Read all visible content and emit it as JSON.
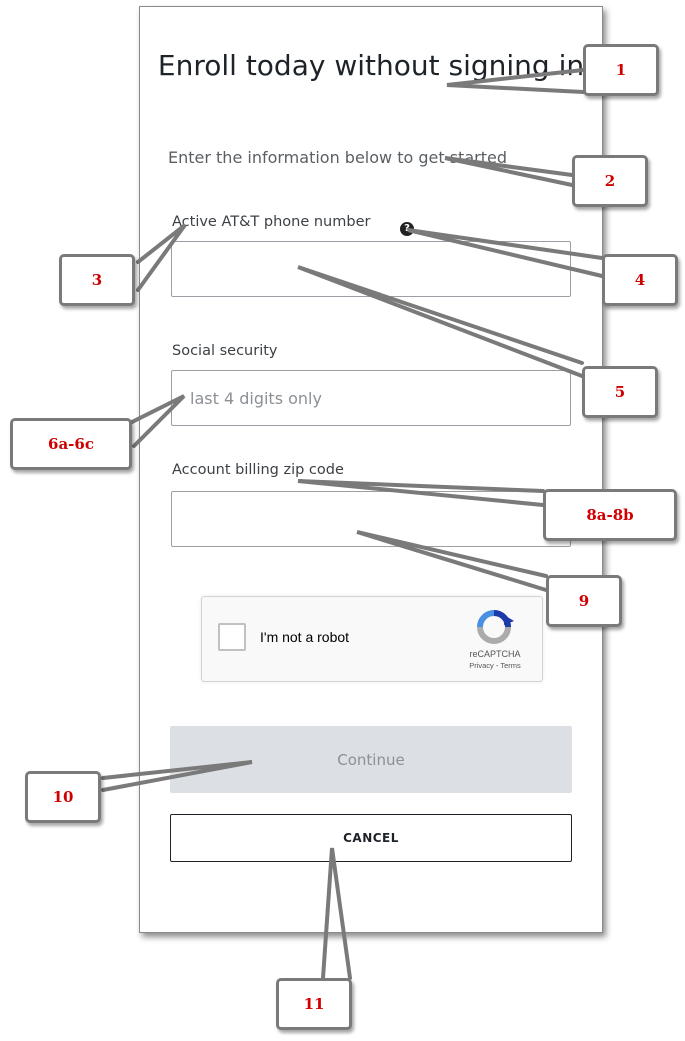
{
  "form": {
    "title": "Enroll today without signing in",
    "subtitle": "Enter the information below to get started",
    "phone": {
      "label": "Active AT&T phone number",
      "value": "",
      "placeholder": ""
    },
    "help_icon": {
      "icon": "question-circle-icon",
      "glyph": "?"
    },
    "ssn": {
      "label": "Social security",
      "value": "",
      "placeholder": "last 4 digits only"
    },
    "zip": {
      "label": "Account billing zip code",
      "value": "",
      "placeholder": ""
    },
    "recaptcha": {
      "label": "I'm not a robot",
      "brand": "reCAPTCHA",
      "links": "Privacy - Terms",
      "checked": false
    },
    "continue_label": "Continue",
    "cancel_label": "CANCEL"
  },
  "callouts": [
    "1",
    "2",
    "3",
    "4",
    "5",
    "6a-6c",
    "8a-8b",
    "9",
    "10",
    "11"
  ],
  "colors": {
    "callout_text": "#d10000",
    "callout_border": "#7a7a7a",
    "continue_bg": "#dcdfe3",
    "continue_text": "#8c9196"
  }
}
